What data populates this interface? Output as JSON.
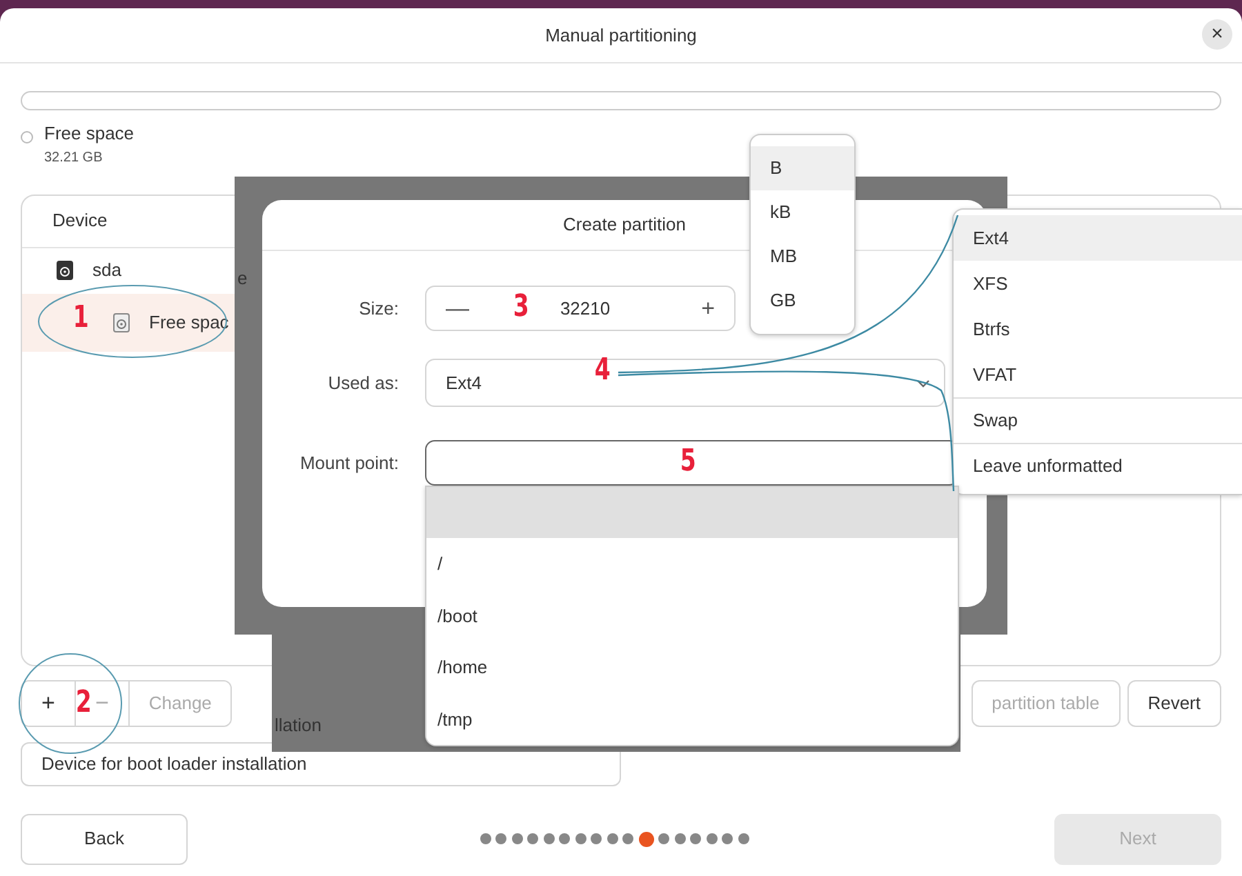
{
  "window": {
    "title": "Manual partitioning",
    "close": "×"
  },
  "legend": [
    {
      "label": "Free space",
      "size": "32.21 GB"
    }
  ],
  "device_table": {
    "columns": [
      "Device"
    ],
    "rows": [
      {
        "name": "sda",
        "kind": "disk",
        "selected": false
      },
      {
        "name": "Free spac",
        "kind": "free",
        "selected": true
      }
    ]
  },
  "covered_fragments": [
    {
      "text": "e"
    },
    {
      "text": "llation"
    }
  ],
  "toolbar": {
    "left": [
      {
        "label": "+",
        "disabled": false
      },
      {
        "label": "−",
        "disabled": true
      },
      {
        "label": "Change",
        "disabled": true
      }
    ],
    "right": [
      {
        "label": "partition table",
        "disabled": true
      },
      {
        "label": "Revert",
        "disabled": false
      }
    ]
  },
  "boot_loader": {
    "value": "Device for boot loader installation"
  },
  "dialog": {
    "title": "Create partition",
    "size": {
      "label": "Size:",
      "decrement": "—",
      "value": "32210",
      "increment": "+"
    },
    "used_as": {
      "label": "Used as:",
      "value": "Ext4"
    },
    "mount_point": {
      "label": "Mount point:"
    }
  },
  "unit_menu": [
    {
      "label": "B",
      "selected": true
    },
    {
      "label": "kB",
      "selected": false
    },
    {
      "label": "MB",
      "selected": false
    },
    {
      "label": "GB",
      "selected": false
    }
  ],
  "type_menu": [
    {
      "label": "Ext4",
      "selected": true,
      "separator_before": false
    },
    {
      "label": "XFS",
      "selected": false,
      "separator_before": false
    },
    {
      "label": "Btrfs",
      "selected": false,
      "separator_before": false
    },
    {
      "label": "VFAT",
      "selected": false,
      "separator_before": false
    },
    {
      "label": "Swap",
      "selected": false,
      "separator_before": true
    },
    {
      "label": "Leave unformatted",
      "selected": false,
      "separator_before": true
    }
  ],
  "mount_menu": [
    {
      "selected": true
    },
    {
      "label": "/",
      "selected": false
    },
    {
      "label": "/boot",
      "selected": false
    },
    {
      "label": "/home",
      "selected": false
    },
    {
      "label": "/tmp",
      "selected": false
    }
  ],
  "annotations": [
    {
      "label": "1"
    },
    {
      "label": "2"
    },
    {
      "label": "3"
    },
    {
      "label": "4"
    },
    {
      "label": "5"
    }
  ],
  "nav": {
    "back": "Back",
    "next": "Next",
    "next_disabled": true,
    "dots": [
      {
        "selected": false
      },
      {
        "selected": false
      },
      {
        "selected": false
      },
      {
        "selected": false
      },
      {
        "selected": false
      },
      {
        "selected": false
      },
      {
        "selected": false
      },
      {
        "selected": false
      },
      {
        "selected": false
      },
      {
        "selected": false
      },
      {
        "selected": true
      },
      {
        "selected": false
      },
      {
        "selected": false
      },
      {
        "selected": false
      },
      {
        "selected": false
      },
      {
        "selected": false
      },
      {
        "selected": false
      }
    ]
  }
}
